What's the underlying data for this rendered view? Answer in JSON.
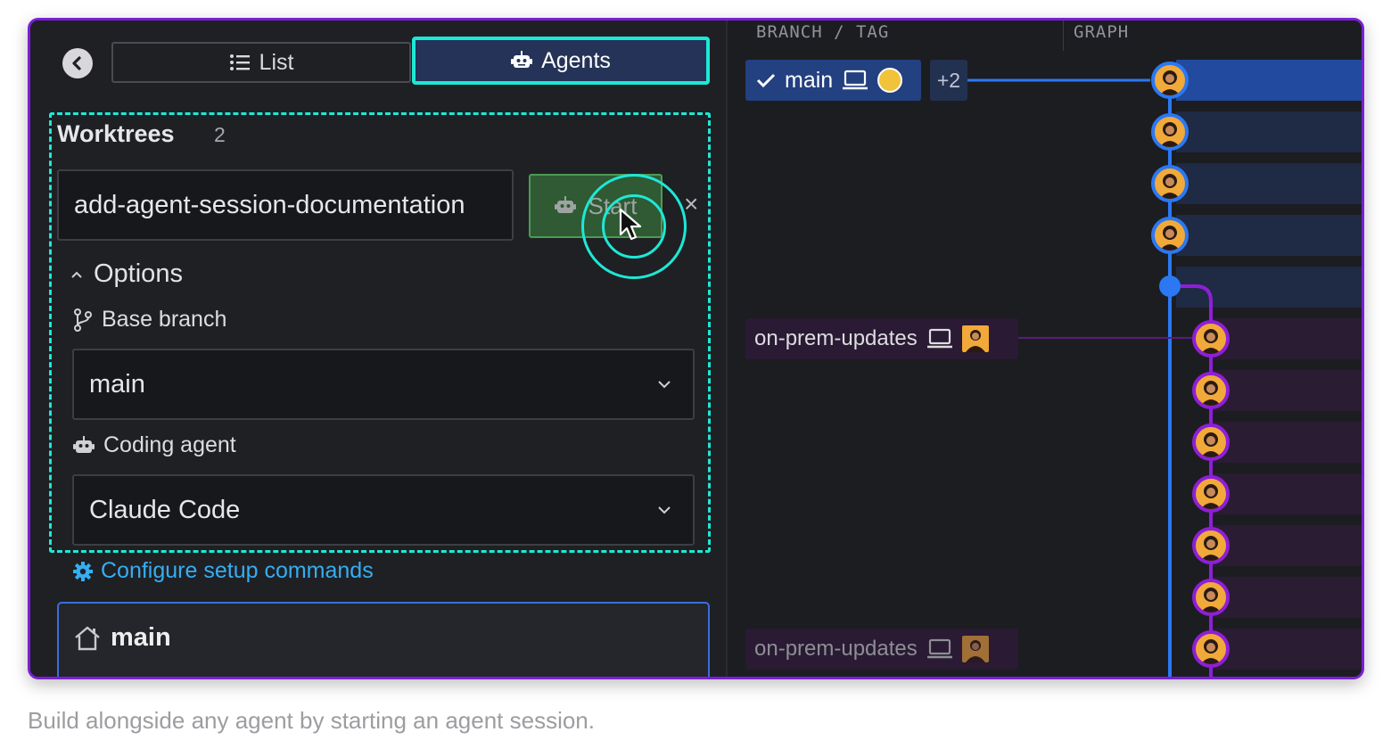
{
  "tabs": {
    "list_label": "List",
    "agents_label": "Agents"
  },
  "worktrees": {
    "title": "Worktrees",
    "count": "2",
    "name_value": "add-agent-session-documentation",
    "start_label": "Start",
    "close_symbol": "×"
  },
  "options": {
    "heading": "Options",
    "base_branch_label": "Base branch",
    "base_branch_value": "main",
    "coding_agent_label": "Coding agent",
    "coding_agent_value": "Claude Code",
    "configure_link": "Configure setup commands"
  },
  "main_worktree": {
    "label": "main"
  },
  "graph": {
    "col_branch": "BRANCH / TAG",
    "col_graph": "GRAPH",
    "current_branch": "main",
    "extra_refs": "+2",
    "branch_a": "on-prem-updates",
    "branch_b": "on-prem-updates"
  },
  "caption": "Build alongside any agent by starting an agent session.",
  "colors": {
    "accent_teal": "#1ee8d6",
    "frame_purple": "#7a1fd6",
    "main_line_blue": "#2b78f2",
    "branch_line_purple": "#8f1ed8",
    "link_blue": "#35aef2"
  },
  "icons": [
    "back-arrow-icon",
    "list-icon",
    "robot-icon",
    "close-icon",
    "chevron-up-icon",
    "branch-icon",
    "chevron-down-icon",
    "gear-icon",
    "home-icon",
    "check-icon",
    "laptop-icon",
    "cursor-icon"
  ]
}
